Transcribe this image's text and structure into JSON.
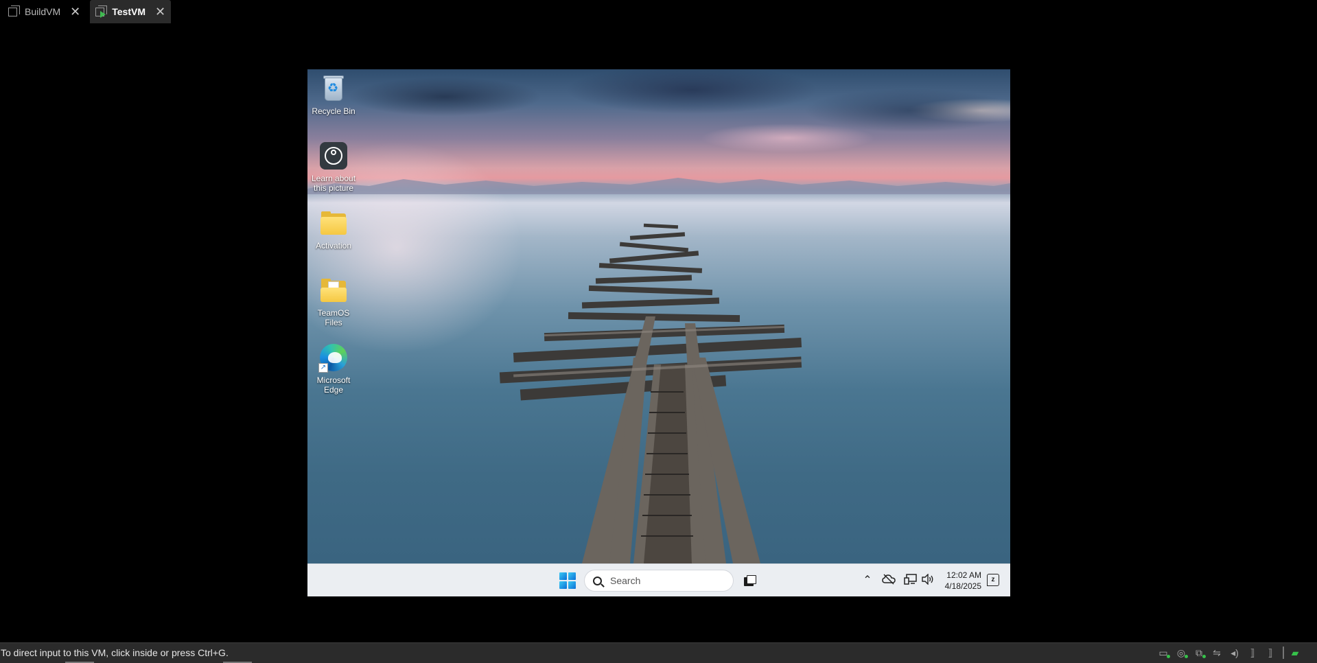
{
  "host": {
    "tabs": [
      {
        "label": "BuildVM",
        "active": false
      },
      {
        "label": "TestVM",
        "active": true
      }
    ],
    "status_message": "To direct input to this VM, click inside or press Ctrl+G."
  },
  "desktop": {
    "icons": [
      {
        "label": "Recycle Bin",
        "icon": "recycle-bin-icon"
      },
      {
        "label": "Learn about this picture",
        "icon": "learn-about-picture-icon"
      },
      {
        "label": "Activation",
        "icon": "folder-icon"
      },
      {
        "label": "TeamOS Files",
        "icon": "folder-icon"
      },
      {
        "label": "Microsoft Edge",
        "icon": "edge-icon"
      }
    ]
  },
  "taskbar": {
    "search_placeholder": "Search",
    "clock": {
      "time": "12:02 AM",
      "date": "4/18/2025"
    },
    "accent": "#0a6fd6"
  }
}
